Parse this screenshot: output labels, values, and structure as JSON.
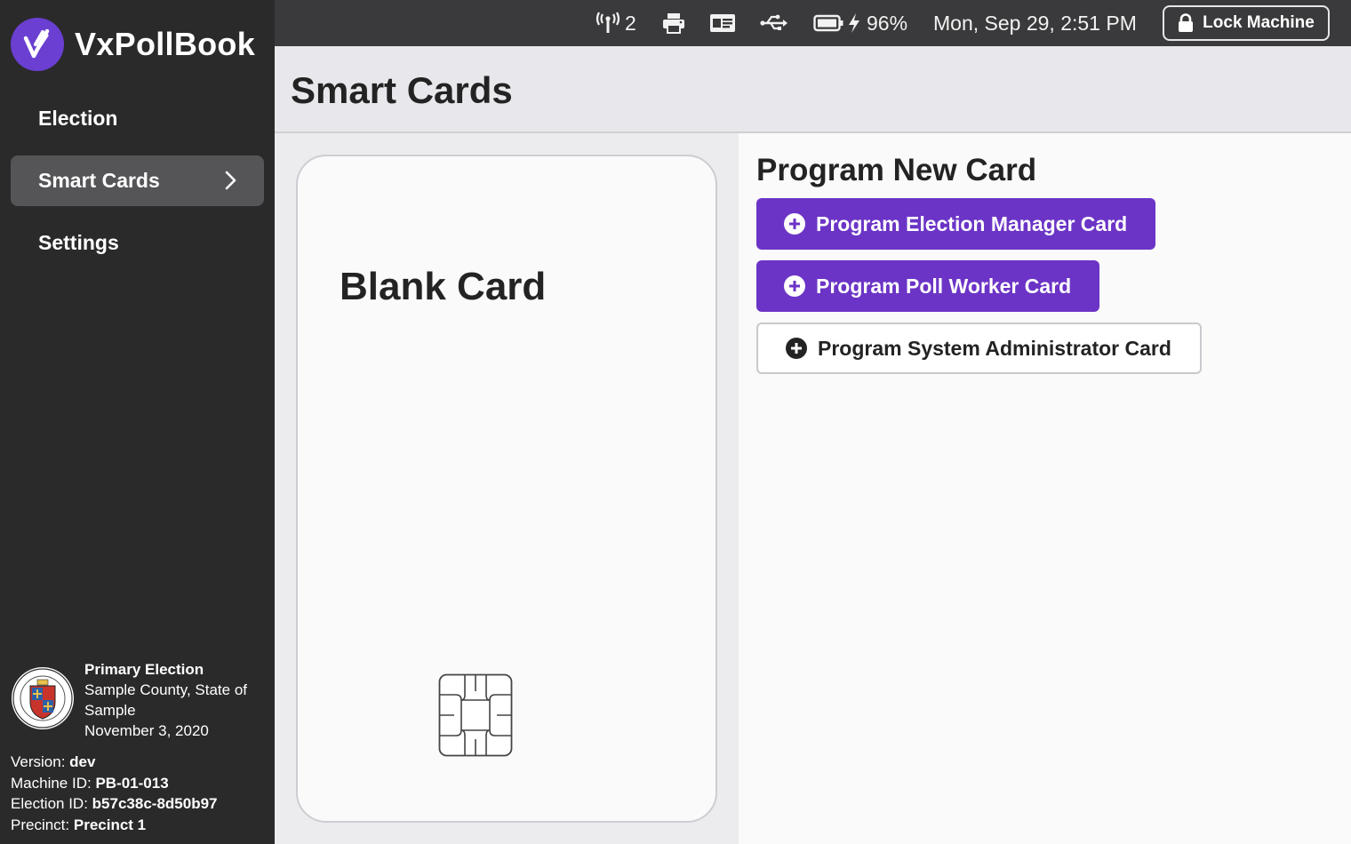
{
  "app": {
    "name": "VxPollBook"
  },
  "sidebar": {
    "items": [
      {
        "label": "Election",
        "active": false
      },
      {
        "label": "Smart Cards",
        "active": true
      },
      {
        "label": "Settings",
        "active": false
      }
    ],
    "election": {
      "title": "Primary Election",
      "location": "Sample County, State of Sample",
      "date": "November 3, 2020"
    },
    "machine": {
      "version_label": "Version:",
      "version": "dev",
      "machine_id_label": "Machine ID:",
      "machine_id": "PB-01-013",
      "election_id_label": "Election ID:",
      "election_id": "b57c38c-8d50b97",
      "precinct_label": "Precinct:",
      "precinct": "Precinct 1"
    }
  },
  "status": {
    "network_count": "2",
    "battery_percent": "96%",
    "datetime": "Mon, Sep 29, 2:51 PM",
    "lock_label": "Lock Machine",
    "icons": [
      "antenna-icon",
      "printer-icon",
      "card-reader-icon",
      "usb-icon",
      "battery-icon",
      "charging-icon",
      "lock-icon"
    ]
  },
  "page": {
    "title": "Smart Cards"
  },
  "card": {
    "label": "Blank Card"
  },
  "program": {
    "title": "Program New Card",
    "buttons": {
      "election_manager": "Program Election Manager Card",
      "poll_worker": "Program Poll Worker Card",
      "system_admin": "Program System Administrator Card"
    }
  },
  "colors": {
    "accent": "#6b34c6",
    "sidebar_bg": "#2a2a2a",
    "topbar_bg": "#3a3a3c",
    "nav_active": "#555558"
  }
}
